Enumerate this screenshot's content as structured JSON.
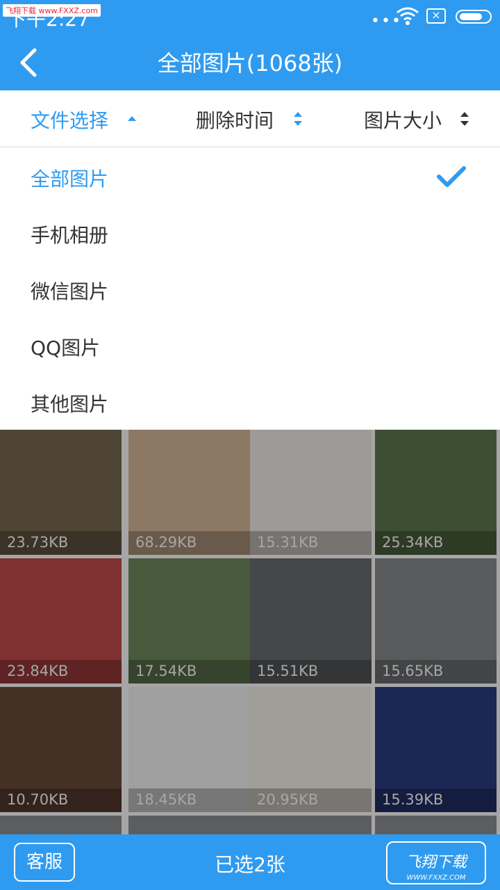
{
  "status": {
    "time": "下午2:27",
    "watermark": "飞翔下载 www.FXXZ.com"
  },
  "header": {
    "title": "全部图片(1068张)"
  },
  "sort": [
    {
      "label": "文件选择"
    },
    {
      "label": "删除时间"
    },
    {
      "label": "图片大小"
    }
  ],
  "filters": [
    {
      "label": "全部图片"
    },
    {
      "label": "手机相册"
    },
    {
      "label": "微信图片"
    },
    {
      "label": "QQ图片"
    },
    {
      "label": "其他图片"
    }
  ],
  "grid": [
    {
      "size": "23.73KB",
      "color": "#7a6a52"
    },
    {
      "size": "68.29KB",
      "color": "#d8b89a"
    },
    {
      "size": "15.31KB",
      "color": "#f2ede8"
    },
    {
      "size": "25.34KB",
      "color": "#5e7a4e"
    },
    {
      "size": "23.84KB",
      "color": "#c44a4a"
    },
    {
      "size": "17.54KB",
      "color": "#6f8a5c"
    },
    {
      "size": "15.51KB",
      "color": "#6c6e70"
    },
    {
      "size": "15.65KB",
      "color": "#8a8c8e"
    },
    {
      "size": "10.70KB",
      "color": "#6a4a3a"
    },
    {
      "size": "18.45KB",
      "color": "#f4f4f4"
    },
    {
      "size": "20.95KB",
      "color": "#f8f2ea"
    },
    {
      "size": "15.39KB",
      "color": "#2b3c84"
    }
  ],
  "bottom": {
    "service": "客服",
    "selected": "已选2张",
    "watermark": "飞翔下载",
    "watermark_url": "WWW.FXXZ.COM"
  },
  "colors": {
    "accent": "#2f9bf0",
    "text": "#333333"
  }
}
